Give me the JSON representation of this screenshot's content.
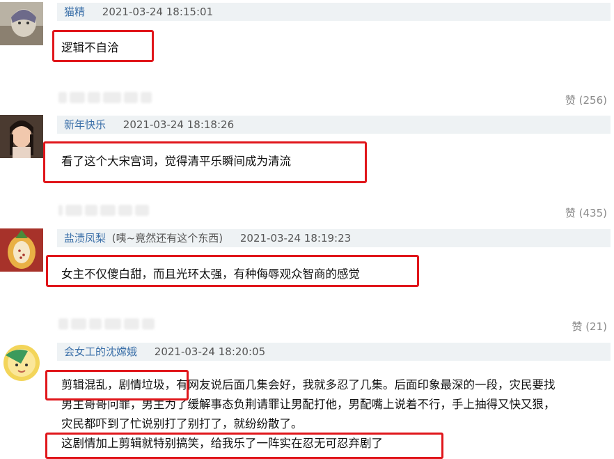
{
  "comments": [
    {
      "username": "猫精",
      "note": "",
      "time": "2021-03-24 18:15:01",
      "content": "逻辑不自洽",
      "likes": "赞 (256)"
    },
    {
      "username": "新年快乐",
      "note": "",
      "time": "2021-03-24 18:18:26",
      "content": "看了这个大宋宫词，觉得清平乐瞬间成为清流",
      "likes": "赞 (435)"
    },
    {
      "username": "盐渍凤梨",
      "note": "(咦~竟然还有这个东西)",
      "time": "2021-03-24 18:19:23",
      "content": "女主不仅傻白甜，而且光环太强，有种侮辱观众智商的感觉",
      "likes": "赞 (21)"
    },
    {
      "username": "会女工的沈嫦娥",
      "note": "",
      "time": "2021-03-24 18:20:05",
      "lines": [
        "剪辑混乱，剧情垃圾，有网友说后面几集会好，我就多忍了几集。后面印象最深的一段，灾民要找",
        "男主哥哥问罪，男主为了缓解事态负荆请罪让男配打他，男配嘴上说着不行，手上抽得又快又狠，",
        "灾民都吓到了忙说别打了别打了，就纷纷散了。",
        "这剧情加上剪辑就特别搞笑，给我乐了一阵实在忍无可忍弃剧了"
      ]
    }
  ],
  "colors": {
    "highlight_border": "#e0161b",
    "username": "#3a6fa8",
    "header_bg": "#eef2f4",
    "likes": "#8a8a8a"
  }
}
